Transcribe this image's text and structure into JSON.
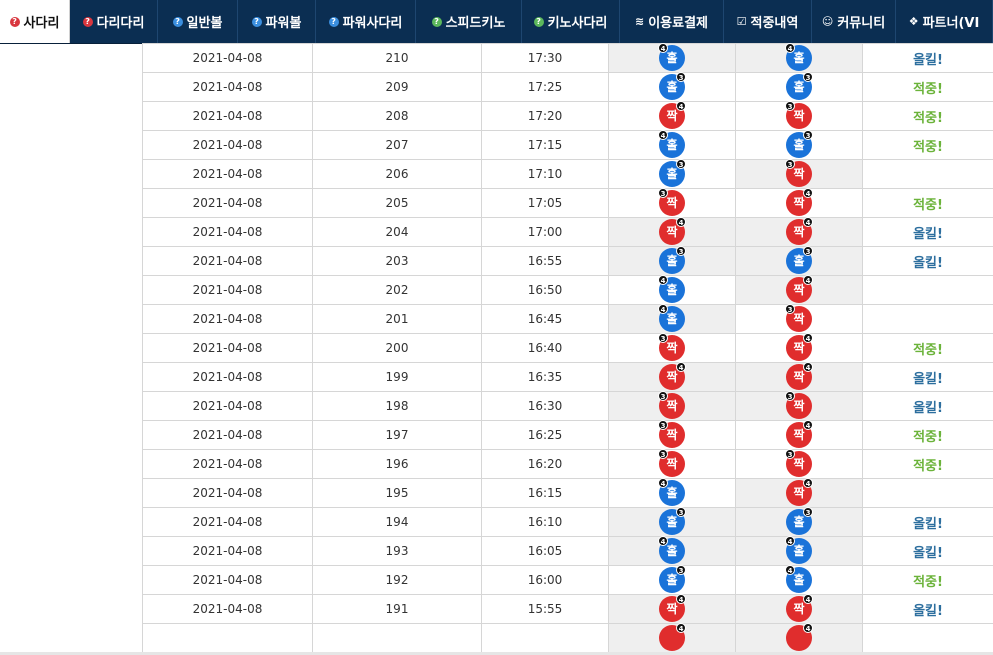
{
  "nav": {
    "tabs": [
      {
        "label": "사다리",
        "icon": "question-icon",
        "icon_glyph": "?",
        "icon_color": "#d9363e",
        "active": true
      },
      {
        "label": "다리다리",
        "icon": "question-icon",
        "icon_glyph": "?",
        "icon_color": "#d9363e",
        "active": false
      },
      {
        "label": "일반볼",
        "icon": "question-icon",
        "icon_glyph": "?",
        "icon_color": "#3b8fe0",
        "active": false
      },
      {
        "label": "파워볼",
        "icon": "question-icon",
        "icon_glyph": "?",
        "icon_color": "#3b8fe0",
        "active": false
      },
      {
        "label": "파워사다리",
        "icon": "question-icon",
        "icon_glyph": "?",
        "icon_color": "#3b8fe0",
        "active": false
      },
      {
        "label": "스피드키노",
        "icon": "question-icon",
        "icon_glyph": "?",
        "icon_color": "#5cb85c",
        "active": false
      },
      {
        "label": "키노사다리",
        "icon": "question-icon",
        "icon_glyph": "?",
        "icon_color": "#5cb85c",
        "active": false
      },
      {
        "label": "이용료결제",
        "icon": "database-icon",
        "icon_glyph": "≋",
        "icon_color": "#ffffff",
        "active": false
      },
      {
        "label": "적중내역",
        "icon": "checkbox-icon",
        "icon_glyph": "☑",
        "icon_color": "#ffffff",
        "active": false
      },
      {
        "label": "커뮤니티",
        "icon": "smile-icon",
        "icon_glyph": "☺",
        "icon_color": "#ffffff",
        "active": false
      },
      {
        "label": "파트너(VI",
        "icon": "cubes-icon",
        "icon_glyph": "❖",
        "icon_color": "#ffffff",
        "active": false
      }
    ]
  },
  "colors": {
    "odd": "#1a73d9",
    "even": "#e02d2d",
    "hit": "#6bb33a",
    "allkill": "#2c6e9e",
    "nav": "#0b2e52"
  },
  "rows": [
    {
      "date": "2021-04-08",
      "round": "210",
      "time": "17:30",
      "actual": {
        "label": "홀",
        "type": "odd",
        "badge": "4",
        "badge_side": "l"
      },
      "pick": {
        "label": "홀",
        "type": "odd",
        "badge": "4",
        "badge_side": "l"
      },
      "result": "올킬!",
      "result_type": "allkill",
      "hl": "both"
    },
    {
      "date": "2021-04-08",
      "round": "209",
      "time": "17:25",
      "actual": {
        "label": "홀",
        "type": "odd",
        "badge": "3",
        "badge_side": "r"
      },
      "pick": {
        "label": "홀",
        "type": "odd",
        "badge": "3",
        "badge_side": "r"
      },
      "result": "적중!",
      "result_type": "hit",
      "hl": "none"
    },
    {
      "date": "2021-04-08",
      "round": "208",
      "time": "17:20",
      "actual": {
        "label": "짝",
        "type": "even",
        "badge": "4",
        "badge_side": "r"
      },
      "pick": {
        "label": "짝",
        "type": "even",
        "badge": "3",
        "badge_side": "l"
      },
      "result": "적중!",
      "result_type": "hit",
      "hl": "none"
    },
    {
      "date": "2021-04-08",
      "round": "207",
      "time": "17:15",
      "actual": {
        "label": "홀",
        "type": "odd",
        "badge": "4",
        "badge_side": "l"
      },
      "pick": {
        "label": "홀",
        "type": "odd",
        "badge": "3",
        "badge_side": "r"
      },
      "result": "적중!",
      "result_type": "hit",
      "hl": "none"
    },
    {
      "date": "2021-04-08",
      "round": "206",
      "time": "17:10",
      "actual": {
        "label": "홀",
        "type": "odd",
        "badge": "3",
        "badge_side": "r"
      },
      "pick": {
        "label": "짝",
        "type": "even",
        "badge": "3",
        "badge_side": "l"
      },
      "result": "",
      "result_type": "",
      "hl": "pick"
    },
    {
      "date": "2021-04-08",
      "round": "205",
      "time": "17:05",
      "actual": {
        "label": "짝",
        "type": "even",
        "badge": "3",
        "badge_side": "l"
      },
      "pick": {
        "label": "짝",
        "type": "even",
        "badge": "4",
        "badge_side": "r"
      },
      "result": "적중!",
      "result_type": "hit",
      "hl": "none"
    },
    {
      "date": "2021-04-08",
      "round": "204",
      "time": "17:00",
      "actual": {
        "label": "짝",
        "type": "even",
        "badge": "4",
        "badge_side": "r"
      },
      "pick": {
        "label": "짝",
        "type": "even",
        "badge": "4",
        "badge_side": "r"
      },
      "result": "올킬!",
      "result_type": "allkill",
      "hl": "both"
    },
    {
      "date": "2021-04-08",
      "round": "203",
      "time": "16:55",
      "actual": {
        "label": "홀",
        "type": "odd",
        "badge": "3",
        "badge_side": "r"
      },
      "pick": {
        "label": "홀",
        "type": "odd",
        "badge": "3",
        "badge_side": "r"
      },
      "result": "올킬!",
      "result_type": "allkill",
      "hl": "both"
    },
    {
      "date": "2021-04-08",
      "round": "202",
      "time": "16:50",
      "actual": {
        "label": "홀",
        "type": "odd",
        "badge": "4",
        "badge_side": "l"
      },
      "pick": {
        "label": "짝",
        "type": "even",
        "badge": "4",
        "badge_side": "r"
      },
      "result": "",
      "result_type": "",
      "hl": "pick"
    },
    {
      "date": "2021-04-08",
      "round": "201",
      "time": "16:45",
      "actual": {
        "label": "홀",
        "type": "odd",
        "badge": "4",
        "badge_side": "l"
      },
      "pick": {
        "label": "짝",
        "type": "even",
        "badge": "3",
        "badge_side": "l"
      },
      "result": "",
      "result_type": "",
      "hl": "actual"
    },
    {
      "date": "2021-04-08",
      "round": "200",
      "time": "16:40",
      "actual": {
        "label": "짝",
        "type": "even",
        "badge": "3",
        "badge_side": "l"
      },
      "pick": {
        "label": "짝",
        "type": "even",
        "badge": "4",
        "badge_side": "r"
      },
      "result": "적중!",
      "result_type": "hit",
      "hl": "none"
    },
    {
      "date": "2021-04-08",
      "round": "199",
      "time": "16:35",
      "actual": {
        "label": "짝",
        "type": "even",
        "badge": "4",
        "badge_side": "r"
      },
      "pick": {
        "label": "짝",
        "type": "even",
        "badge": "4",
        "badge_side": "r"
      },
      "result": "올킬!",
      "result_type": "allkill",
      "hl": "both"
    },
    {
      "date": "2021-04-08",
      "round": "198",
      "time": "16:30",
      "actual": {
        "label": "짝",
        "type": "even",
        "badge": "3",
        "badge_side": "l"
      },
      "pick": {
        "label": "짝",
        "type": "even",
        "badge": "3",
        "badge_side": "l"
      },
      "result": "올킬!",
      "result_type": "allkill",
      "hl": "both"
    },
    {
      "date": "2021-04-08",
      "round": "197",
      "time": "16:25",
      "actual": {
        "label": "짝",
        "type": "even",
        "badge": "3",
        "badge_side": "l"
      },
      "pick": {
        "label": "짝",
        "type": "even",
        "badge": "4",
        "badge_side": "r"
      },
      "result": "적중!",
      "result_type": "hit",
      "hl": "none"
    },
    {
      "date": "2021-04-08",
      "round": "196",
      "time": "16:20",
      "actual": {
        "label": "짝",
        "type": "even",
        "badge": "3",
        "badge_side": "l"
      },
      "pick": {
        "label": "짝",
        "type": "even",
        "badge": "3",
        "badge_side": "l"
      },
      "result": "적중!",
      "result_type": "hit",
      "hl": "none"
    },
    {
      "date": "2021-04-08",
      "round": "195",
      "time": "16:15",
      "actual": {
        "label": "홀",
        "type": "odd",
        "badge": "4",
        "badge_side": "l"
      },
      "pick": {
        "label": "짝",
        "type": "even",
        "badge": "4",
        "badge_side": "r"
      },
      "result": "",
      "result_type": "",
      "hl": "pick"
    },
    {
      "date": "2021-04-08",
      "round": "194",
      "time": "16:10",
      "actual": {
        "label": "홀",
        "type": "odd",
        "badge": "3",
        "badge_side": "r"
      },
      "pick": {
        "label": "홀",
        "type": "odd",
        "badge": "3",
        "badge_side": "r"
      },
      "result": "올킬!",
      "result_type": "allkill",
      "hl": "both"
    },
    {
      "date": "2021-04-08",
      "round": "193",
      "time": "16:05",
      "actual": {
        "label": "홀",
        "type": "odd",
        "badge": "4",
        "badge_side": "l"
      },
      "pick": {
        "label": "홀",
        "type": "odd",
        "badge": "4",
        "badge_side": "l"
      },
      "result": "올킬!",
      "result_type": "allkill",
      "hl": "both"
    },
    {
      "date": "2021-04-08",
      "round": "192",
      "time": "16:00",
      "actual": {
        "label": "홀",
        "type": "odd",
        "badge": "3",
        "badge_side": "r"
      },
      "pick": {
        "label": "홀",
        "type": "odd",
        "badge": "4",
        "badge_side": "l"
      },
      "result": "적중!",
      "result_type": "hit",
      "hl": "none"
    },
    {
      "date": "2021-04-08",
      "round": "191",
      "time": "15:55",
      "actual": {
        "label": "짝",
        "type": "even",
        "badge": "4",
        "badge_side": "r"
      },
      "pick": {
        "label": "짝",
        "type": "even",
        "badge": "4",
        "badge_side": "r"
      },
      "result": "올킬!",
      "result_type": "allkill",
      "hl": "both"
    },
    {
      "date": "",
      "round": "",
      "time": "",
      "actual": {
        "label": "",
        "type": "even",
        "badge": "4",
        "badge_side": "r"
      },
      "pick": {
        "label": "",
        "type": "even",
        "badge": "4",
        "badge_side": "r"
      },
      "result": "",
      "result_type": "",
      "hl": "both"
    }
  ]
}
